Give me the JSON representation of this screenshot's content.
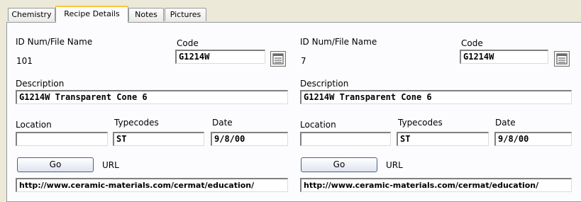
{
  "tabs": [
    "Chemistry",
    "Recipe Details",
    "Notes",
    "Pictures"
  ],
  "labels": {
    "id_num": "ID Num/File Name",
    "code": "Code",
    "description": "Description",
    "location": "Location",
    "typecodes": "Typecodes",
    "date": "Date",
    "go": "Go",
    "url": "URL"
  },
  "left": {
    "id_value": "101",
    "code": "G1214W",
    "description": "G1214W Transparent Cone 6",
    "location": "",
    "typecodes": "ST",
    "date": "9/8/00",
    "url": "http://www.ceramic-materials.com/cermat/education/"
  },
  "right": {
    "id_value": "7",
    "code": "G1214W",
    "description": "G1214W Transparent Cone 6",
    "location": "",
    "typecodes": "ST",
    "date": "9/8/00",
    "url": "http://www.ceramic-materials.com/cermat/education/"
  },
  "icons": {
    "picker": "table-icon"
  }
}
